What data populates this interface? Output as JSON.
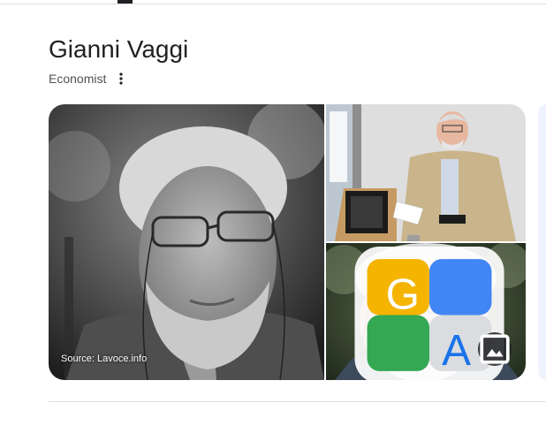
{
  "header": {
    "title": "Gianni Vaggi",
    "subtitle": "Economist",
    "more_icon": "more-vert-icon"
  },
  "gallery": {
    "images": [
      {
        "role": "main-portrait",
        "style": "black-and-white",
        "source_label": "Source: Lavoce.info"
      },
      {
        "role": "lecture-photo",
        "style": "color"
      },
      {
        "role": "close-up-portrait",
        "style": "color",
        "badge_icon": "google-lens-icon",
        "action_icon": "image-icon"
      }
    ]
  },
  "colors": {
    "text_primary": "#202124",
    "text_secondary": "#4d5156",
    "divider": "#dadce0",
    "next_card": "#eef3fd"
  }
}
